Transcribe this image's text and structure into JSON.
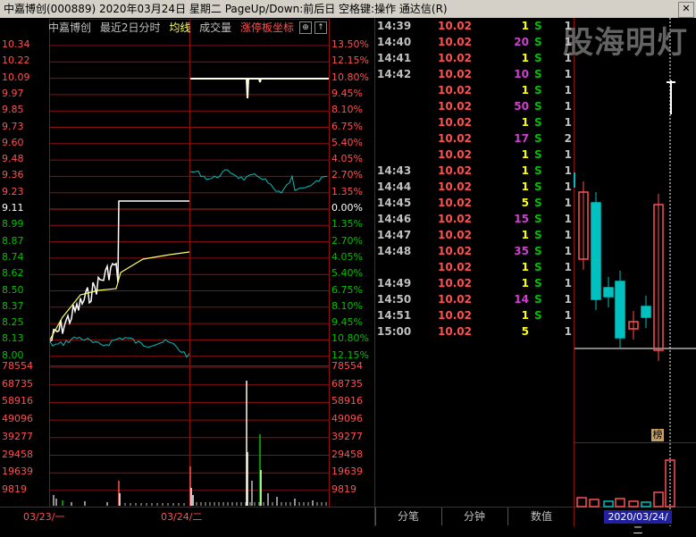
{
  "window": {
    "title": "中嘉博创(000889)  2020年03月24日 星期二 PageUp/Down:前后日 空格键:操作 通达信(R)",
    "close_symbol": "✕"
  },
  "watermark": "股海明灯",
  "chart_header": {
    "stock_name": "中嘉博创",
    "period": "最近2日分时",
    "avg_line": "均线",
    "volume": "成交量",
    "limit_coord": "涨停板坐标"
  },
  "colors": {
    "up": "#ff5050",
    "down": "#00c0c0",
    "flat": "#ffffff",
    "avg": "#ffff60",
    "grid": "#8b1010",
    "sell": "#00c000",
    "purple": "#d040d0",
    "yellow": "#ffff00"
  },
  "price_axis": [
    "10.34",
    "10.22",
    "10.09",
    "9.97",
    "9.85",
    "9.73",
    "9.60",
    "9.48",
    "9.36",
    "9.23",
    "9.11",
    "8.99",
    "8.87",
    "8.74",
    "8.62",
    "8.50",
    "8.37",
    "8.25",
    "8.13",
    "8.00"
  ],
  "pct_axis": [
    "13.50%",
    "12.15%",
    "10.80%",
    "9.45%",
    "8.10%",
    "6.75%",
    "5.40%",
    "4.05%",
    "2.70%",
    "1.35%",
    "0.00%",
    "1.35%",
    "2.70%",
    "4.05%",
    "5.40%",
    "6.75%",
    "8.10%",
    "9.45%",
    "10.80%",
    "12.15%"
  ],
  "volume_axis": [
    "78554",
    "68735",
    "58916",
    "49096",
    "39277",
    "29458",
    "19639",
    "9819"
  ],
  "dates": [
    "03/23/一",
    "03/24/二"
  ],
  "trades": [
    {
      "time": "14:39",
      "price": "10.02",
      "vol": "1",
      "side": "S",
      "count": "1"
    },
    {
      "time": "14:40",
      "price": "10.02",
      "vol": "20",
      "side": "S",
      "count": "1"
    },
    {
      "time": "14:41",
      "price": "10.02",
      "vol": "1",
      "side": "S",
      "count": "1"
    },
    {
      "time": "14:42",
      "price": "10.02",
      "vol": "10",
      "side": "S",
      "count": "1"
    },
    {
      "time": "",
      "price": "10.02",
      "vol": "1",
      "side": "S",
      "count": "1"
    },
    {
      "time": "",
      "price": "10.02",
      "vol": "50",
      "side": "S",
      "count": "1"
    },
    {
      "time": "",
      "price": "10.02",
      "vol": "1",
      "side": "S",
      "count": "1"
    },
    {
      "time": "",
      "price": "10.02",
      "vol": "17",
      "side": "S",
      "count": "2"
    },
    {
      "time": "",
      "price": "10.02",
      "vol": "1",
      "side": "S",
      "count": "1"
    },
    {
      "time": "14:43",
      "price": "10.02",
      "vol": "1",
      "side": "S",
      "count": "1"
    },
    {
      "time": "14:44",
      "price": "10.02",
      "vol": "1",
      "side": "S",
      "count": "1"
    },
    {
      "time": "14:45",
      "price": "10.02",
      "vol": "5",
      "side": "S",
      "count": "1"
    },
    {
      "time": "14:46",
      "price": "10.02",
      "vol": "15",
      "side": "S",
      "count": "1"
    },
    {
      "time": "14:47",
      "price": "10.02",
      "vol": "1",
      "side": "S",
      "count": "1"
    },
    {
      "time": "14:48",
      "price": "10.02",
      "vol": "35",
      "side": "S",
      "count": "1"
    },
    {
      "time": "",
      "price": "10.02",
      "vol": "1",
      "side": "S",
      "count": "1"
    },
    {
      "time": "14:49",
      "price": "10.02",
      "vol": "1",
      "side": "S",
      "count": "1"
    },
    {
      "time": "14:50",
      "price": "10.02",
      "vol": "14",
      "side": "S",
      "count": "1"
    },
    {
      "time": "14:51",
      "price": "10.02",
      "vol": "1",
      "side": "S",
      "count": "1"
    },
    {
      "time": "15:00",
      "price": "10.02",
      "vol": "5",
      "side": "",
      "count": "1"
    }
  ],
  "tabs": [
    "分笔",
    "分钟",
    "数值"
  ],
  "kline": {
    "badge": "榜",
    "date_label": "2020/03/24/二"
  }
}
